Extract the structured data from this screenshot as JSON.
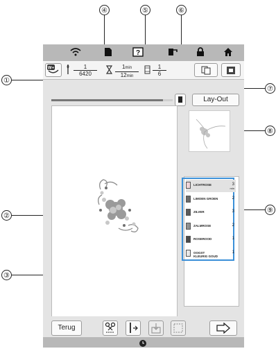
{
  "callouts": [
    "①",
    "②",
    "③",
    "④",
    "⑤",
    "⑥",
    "⑦",
    "⑧",
    "⑨"
  ],
  "top_icons": [
    "wifi-icon",
    "document-icon",
    "help-icon",
    "thread-spool-icon",
    "lock-icon",
    "home-icon"
  ],
  "info": {
    "stitch_current": "1",
    "stitch_total": "6420",
    "time_current": "1",
    "time_current_unit": "min",
    "time_total": "12",
    "time_total_unit": "min",
    "color_current": "1",
    "color_total": "6"
  },
  "buttons": {
    "layout_label": "Lay-Out",
    "back_label": "Terug"
  },
  "progress_percent": 92,
  "threads": [
    {
      "name": "LICHTROSE",
      "count": "3",
      "unit": "min",
      "color": "#f0d4d8",
      "selected": true
    },
    {
      "name": "LIMOEN GROEN",
      "count": "2",
      "color": "#6a6a6a"
    },
    {
      "name": "ZILVER",
      "count": "3",
      "color": "#5a5a5a"
    },
    {
      "name": "ZALMROSE",
      "count": "2",
      "color": "#909090"
    },
    {
      "name": "ROSEROOD",
      "count": "1",
      "color": "#4a4a4a"
    },
    {
      "name": "OOGST\nKLEURIG GOUD",
      "count": "1",
      "color": "#e8e8e8"
    }
  ]
}
